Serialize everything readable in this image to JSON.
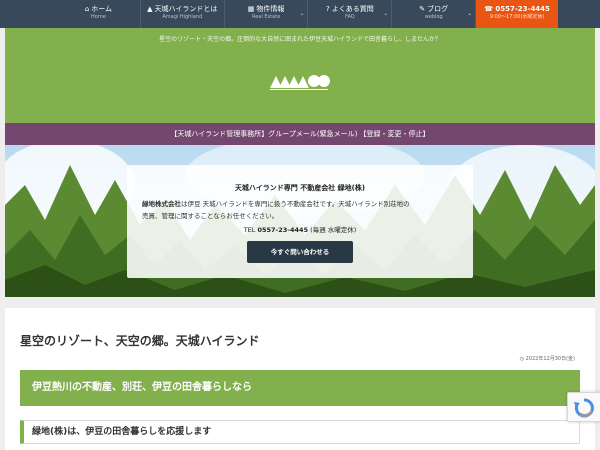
{
  "nav": {
    "items": [
      {
        "icon": "home-icon",
        "label": "ホーム",
        "sub": "Home",
        "chevron": false
      },
      {
        "icon": "tree-icon",
        "label": "天城ハイランドとは",
        "sub": "Amagi Highland",
        "chevron": false
      },
      {
        "icon": "building-icon",
        "label": "物件情報",
        "sub": "Real Estate",
        "chevron": true
      },
      {
        "icon": "question-icon",
        "label": "よくある質問",
        "sub": "FAQ",
        "chevron": true
      },
      {
        "icon": "pencil-icon",
        "label": "ブログ",
        "sub": "weblog",
        "chevron": true
      }
    ],
    "phone": {
      "label": "0557-23-4445",
      "sub": "9:00～17:00(水曜定休)"
    }
  },
  "hero": {
    "tagline": "星空のリゾート・天空の郷。圧倒的な大自然に囲まれた伊豆天城ハイランドで田舎暮らし、しませんか？"
  },
  "announcement": {
    "link": "【天城ハイランド管理事務所】グループメール(緊急メール) 【登録・変更・停止】"
  },
  "card": {
    "title": "天城ハイランド専門 不動産会社 緑地(株)",
    "desc_company": "緑地株式会社",
    "desc_line1_rest": "は伊豆 天城ハイランドを専門に扱う不動産会社です。天城ハイランド別荘地の",
    "desc_line2": "売買、管理に関することならお任せください。",
    "tel_prefix": "TEL",
    "tel_number": "0557-23-4445",
    "tel_note": "(毎週 水曜定休)",
    "button": "今すぐ問い合わせる"
  },
  "post": {
    "title": "星空のリゾート、天空の郷。天城ハイランド",
    "date": "2022年12月30日(金)",
    "heading_green": "伊豆熱川の不動産、別荘、伊豆の田舎暮らしなら",
    "heading_sub": "緑地(株)は、伊豆の田舎暮らしを応援します"
  },
  "colors": {
    "nav_bg": "#37495a",
    "phone_bg": "#e95513",
    "green": "#82b04c",
    "purple": "#744771",
    "button_dark": "#283845"
  }
}
